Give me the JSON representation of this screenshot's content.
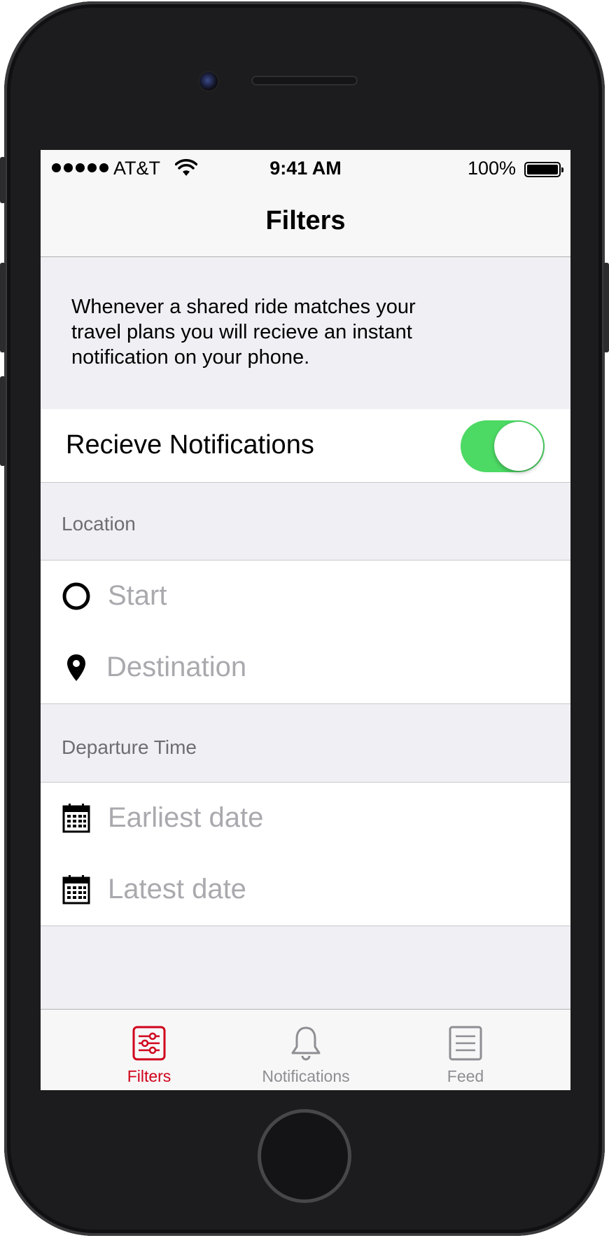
{
  "status_bar": {
    "carrier": "AT&T",
    "time": "9:41 AM",
    "battery": "100%"
  },
  "nav": {
    "title": "Filters"
  },
  "info": {
    "line1": "Whenever a shared ride matches your",
    "line2": "travel plans you will recieve an instant",
    "line3": "notification on your phone."
  },
  "notifications_toggle": {
    "label": "Recieve Notifications",
    "on": true
  },
  "location": {
    "header": "Location",
    "start_placeholder": "Start",
    "destination_placeholder": "Destination"
  },
  "departure": {
    "header": "Departure Time",
    "earliest_placeholder": "Earliest date",
    "latest_placeholder": "Latest date"
  },
  "tabs": [
    {
      "label": "Filters",
      "icon": "sliders-icon",
      "active": true
    },
    {
      "label": "Notifications",
      "icon": "bell-icon",
      "active": false
    },
    {
      "label": "Feed",
      "icon": "feed-icon",
      "active": false
    }
  ],
  "colors": {
    "accent": "#d0021b",
    "toggle_on": "#4cd964",
    "inactive_tab": "#8e8e93"
  }
}
